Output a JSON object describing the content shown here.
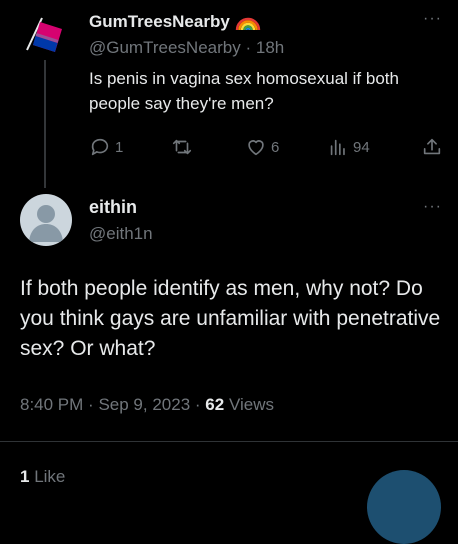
{
  "parent": {
    "name": "GumTreesNearby",
    "handle": "@GumTreesNearby",
    "separator": "·",
    "time": "18h",
    "text": "Is penis in vagina sex homosexual if both people say they're men?",
    "replies": "1",
    "retweets": "",
    "likes": "6",
    "views": "94",
    "menu": "···"
  },
  "main": {
    "name": "eithin",
    "handle": "@eith1n",
    "menu": "···",
    "text": "If both people identify as men, why not? Do you think gays are unfamiliar with penetrative sex? Or what?",
    "time": "8:40 PM",
    "sep1": "·",
    "date": "Sep 9, 2023",
    "sep2": "·",
    "views_count": "62",
    "views_label": "Views",
    "likes_count": "1",
    "likes_label": "Like"
  },
  "colors": {
    "background": "#000000",
    "text": "#e7e9ea",
    "muted": "#71767b",
    "accent": "#1d9bf0"
  }
}
